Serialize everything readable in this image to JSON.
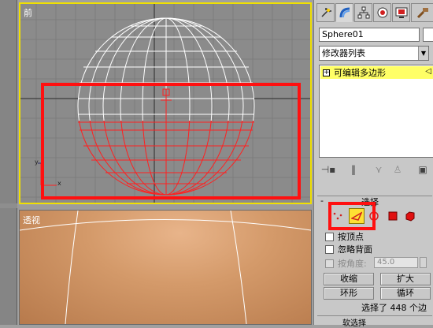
{
  "viewports": {
    "front_label": "前",
    "perspective_label": "透视",
    "axis_x": "x",
    "axis_y": "y"
  },
  "panel": {
    "tabs": [
      "create-icon",
      "modify-icon",
      "hierarchy-icon",
      "motion-icon",
      "display-icon",
      "utilities-icon"
    ],
    "object_name": "Sphere01",
    "object_color": "#ffffff",
    "modifier_list": "修改器列表",
    "stack_item": "可编辑多边形",
    "stack_highlight_color": "#ffff66"
  },
  "selection_rollout": {
    "minus": "-",
    "title": "选择",
    "subobject_modes": [
      "vertex-icon",
      "edge-icon",
      "border-icon",
      "polygon-icon",
      "element-icon"
    ],
    "active_mode": "edge-icon",
    "by_vertex": "按顶点",
    "ignore_backfacing": "忽略背面",
    "by_angle": "按角度:",
    "angle_value": "45.0",
    "shrink": "收缩",
    "grow": "扩大",
    "ring": "环形",
    "loop": "循环",
    "status": "选择了 448 个边"
  },
  "next_rollout_title": "软选择",
  "colors": {
    "highlight": "#ff1010",
    "viewport_active_border": "#f0e000",
    "active_subobject": "#ffe033",
    "wire_white": "#ffffff",
    "wire_selected": "#ff2020"
  }
}
